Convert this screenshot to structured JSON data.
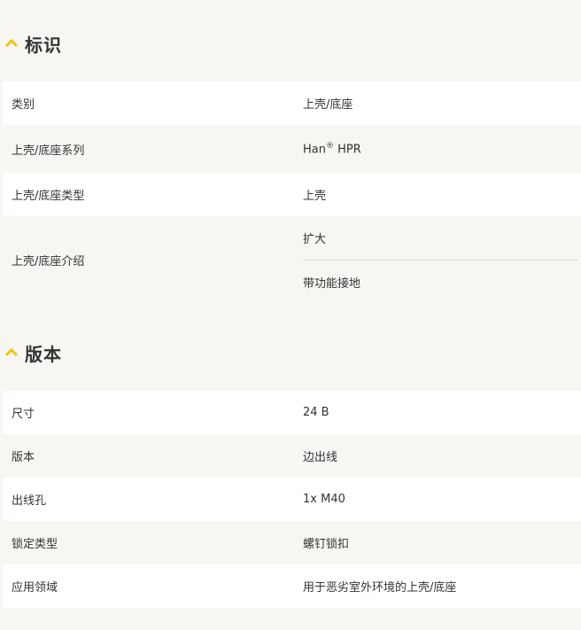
{
  "sections": [
    {
      "title": "标识",
      "rows": [
        {
          "label": "类别",
          "value": "上壳/底座"
        },
        {
          "label": "上壳/底座系列",
          "value_main": "Han",
          "value_sup": "®",
          "value_tail": " HPR"
        },
        {
          "label": "上壳/底座类型",
          "value": "上壳"
        },
        {
          "label": "上壳/底座介绍",
          "values": [
            "扩大",
            "带功能接地"
          ]
        }
      ]
    },
    {
      "title": "版本",
      "rows": [
        {
          "label": "尺寸",
          "value": "24 B"
        },
        {
          "label": "版本",
          "value": "边出线"
        },
        {
          "label": "出线孔",
          "value": "1x M40"
        },
        {
          "label": "锁定类型",
          "value": "螺钉锁扣"
        },
        {
          "label": "应用领域",
          "value": "用于恶劣室外环境的上壳/底座"
        }
      ]
    }
  ],
  "colors": {
    "accent": "#f2c20f",
    "background": "#f7f6f3",
    "row_white": "#ffffff",
    "text": "#333333"
  },
  "icons": {
    "collapse": "chevron-up-icon"
  }
}
